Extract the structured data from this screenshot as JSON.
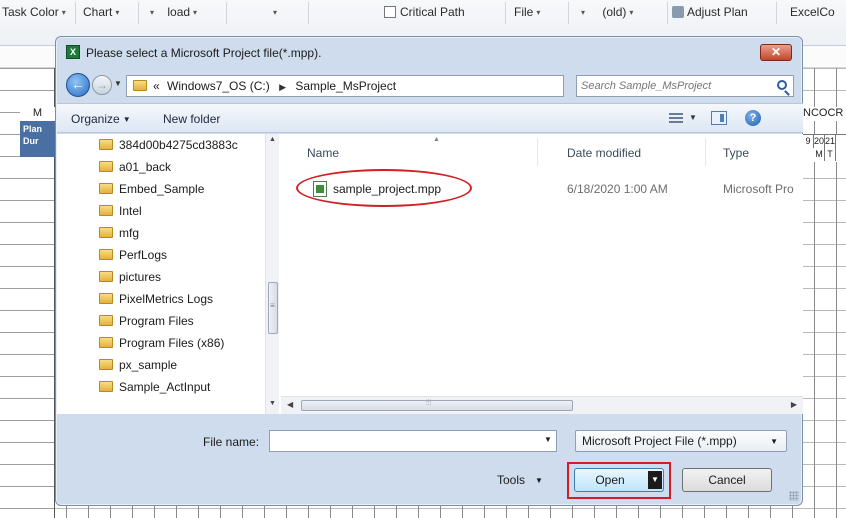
{
  "ribbon": {
    "task_color": "Task Color",
    "chart": "Chart",
    "load": "load",
    "critical_path": "Critical Path",
    "file": "File",
    "old": "(old)",
    "adjust_plan": "Adjust Plan",
    "excel": "ExcelCo"
  },
  "sheet": {
    "col_m": "M",
    "plan": "Plan",
    "dur": "Dur",
    "right_header": "NCOCR",
    "days": [
      "9",
      "20",
      "21"
    ],
    "weekdays": [
      "M",
      "T"
    ]
  },
  "dialog": {
    "title": "Please select a Microsoft Project file(*.mpp).",
    "close": "✕",
    "breadcrumb": [
      "«",
      "Windows7_OS (C:)",
      "Sample_MsProject"
    ],
    "search_placeholder": "Search Sample_MsProject",
    "toolbar": {
      "organize": "Organize",
      "new_folder": "New folder"
    },
    "tree": [
      "384d00b4275cd3883c",
      "a01_back",
      "Embed_Sample",
      "Intel",
      "mfg",
      "PerfLogs",
      "pictures",
      "PixelMetrics Logs",
      "Program Files",
      "Program Files (x86)",
      "px_sample",
      "Sample_ActInput"
    ],
    "columns": {
      "name": "Name",
      "date": "Date modified",
      "type": "Type"
    },
    "files": [
      {
        "name": "sample_project.mpp",
        "date": "6/18/2020 1:00 AM",
        "type": "Microsoft Pro"
      }
    ],
    "file_name_label": "File name:",
    "file_name_value": "",
    "filter": "Microsoft Project File (*.mpp)",
    "tools": "Tools",
    "open": "Open",
    "cancel": "Cancel"
  },
  "colors": {
    "highlight": "#d11f25",
    "plan_header": "#4a6fa3"
  }
}
